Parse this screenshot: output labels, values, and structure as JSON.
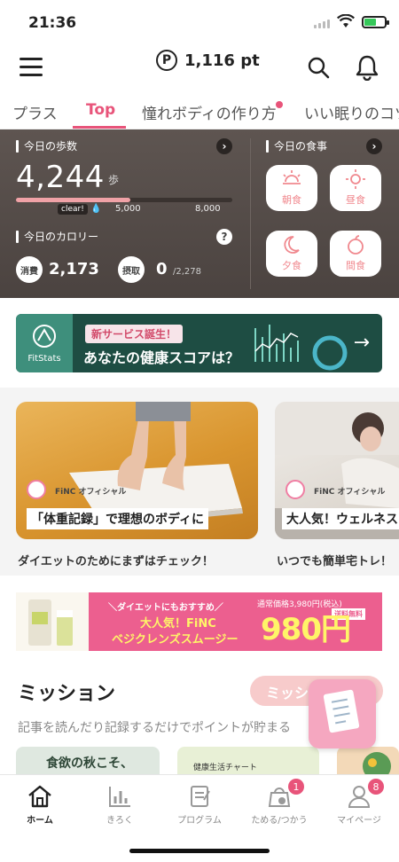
{
  "status_bar": {
    "time": "21:36"
  },
  "header": {
    "points_symbol": "P",
    "points": "1,116 pt"
  },
  "tabs": [
    {
      "label": "プラス"
    },
    {
      "label": "Top"
    },
    {
      "label": "憧れボディの作り方"
    },
    {
      "label": "いい眠りのコツ"
    }
  ],
  "stats": {
    "steps_label": "今日の歩数",
    "steps_value": "4,244",
    "steps_unit": "歩",
    "steps_progress": 0.53,
    "clear_label": "clear!",
    "tick_mid": "5,000",
    "tick_max": "8,000",
    "calorie_label": "今日のカロリー",
    "burn_label": "消費",
    "burn_value": "2,173",
    "intake_label": "摂取",
    "intake_value": "0",
    "intake_target": "/2,278",
    "meal_label": "今日の食事",
    "meals": {
      "breakfast": "朝食",
      "lunch": "昼食",
      "dinner": "夕食",
      "snack": "間食"
    }
  },
  "fitstats": {
    "logo_text": "FitStats",
    "new_badge": "新サービス誕生！",
    "headline": "あなたの健康スコアは？"
  },
  "articles": [
    {
      "author": "FiNC オフィシャル",
      "caption": "「体重記録」で理想のボディに",
      "title": "ダイエットのためにまずはチェック！"
    },
    {
      "author": "FiNC オフィシャル",
      "caption": "大人気！ウェルネス",
      "title": "いつでも簡単宅トレ！"
    }
  ],
  "promo": {
    "line1": "＼ダイエットにもおすすめ／",
    "line2": "大人気！FiNC",
    "line3": "ベジクレンズスムージー",
    "regular": "通常価格3,980円",
    "tax": "(税込)",
    "free_shipping": "送料無料",
    "price": "980円"
  },
  "mission": {
    "title": "ミッション",
    "button": "ミッション",
    "subtitle": "記事を読んだり記録するだけでポイントが貯まる",
    "card1": "食欲の秋こそ、",
    "card2": "健康生活チャート"
  },
  "bottom_nav": [
    {
      "label": "ホーム"
    },
    {
      "label": "きろく"
    },
    {
      "label": "プログラム"
    },
    {
      "label": "ためる/つかう",
      "badge": "1"
    },
    {
      "label": "マイページ",
      "badge": "8"
    }
  ],
  "colors": {
    "accent": "#e8547a",
    "panel": "#554c48",
    "fit_green": "#1e4d43"
  }
}
